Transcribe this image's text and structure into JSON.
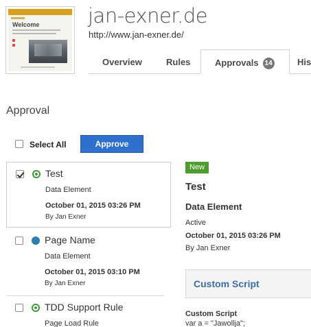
{
  "header": {
    "title": "jan-exner.de",
    "url": "http://www.jan-exner.de/",
    "thumbnail": {
      "heading": "Welcome"
    }
  },
  "tabs": [
    {
      "label": "Overview"
    },
    {
      "label": "Rules"
    },
    {
      "label": "Approvals",
      "count": "14",
      "active": true
    },
    {
      "label": "Hist"
    }
  ],
  "approval": {
    "title": "Approval",
    "select_all_label": "Select All",
    "approve_label": "Approve",
    "items": [
      {
        "name": "Test",
        "type": "Data Element",
        "date": "October 01, 2015 03:26 PM",
        "by": "By Jan Exner",
        "icon": "plus-circle-icon",
        "checked": true
      },
      {
        "name": "Page Name",
        "type": "Data Element",
        "date": "October 01, 2015 03:10 PM",
        "by": "By Jan Exner",
        "icon": "dot-icon",
        "checked": false
      },
      {
        "name": "TDD Support Rule",
        "type": "Page Load Rule",
        "icon": "plus-circle-icon",
        "checked": false
      }
    ]
  },
  "detail": {
    "badge": "New",
    "name": "Test",
    "type": "Data Element",
    "status": "Active",
    "date": "October 01, 2015 03:26 PM",
    "by": "By Jan Exner",
    "panel_title": "Custom Script",
    "script_label": "Custom Script",
    "script_code": "var a = \"Jawollja\";"
  },
  "colors": {
    "approve_button": "#2f6fce",
    "new_badge": "#4e9c2e",
    "panel_title": "#3c6ea6",
    "added_icon": "#3c9a3c",
    "modified_icon": "#2e7fad"
  }
}
